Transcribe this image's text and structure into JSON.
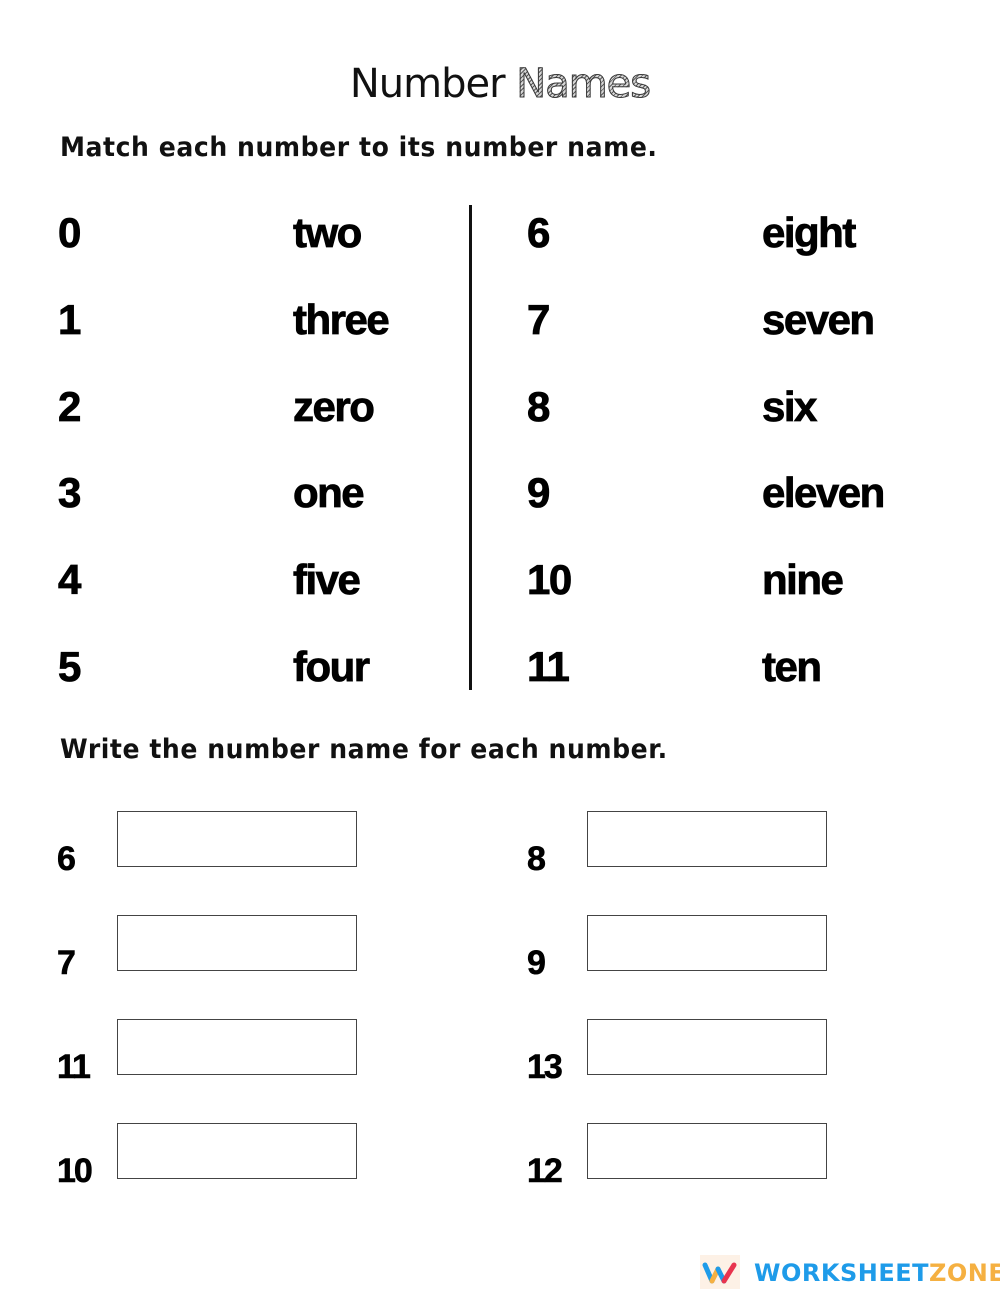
{
  "title": {
    "part1": "Number",
    "part2": "Names"
  },
  "section_match": {
    "instruction": "Match each number to its number name.",
    "left_column": {
      "numbers": [
        "0",
        "1",
        "2",
        "3",
        "4",
        "5"
      ],
      "names": [
        "two",
        "three",
        "zero",
        "one",
        "five",
        "four"
      ]
    },
    "right_column": {
      "numbers": [
        "6",
        "7",
        "8",
        "9",
        "10",
        "11"
      ],
      "names": [
        "eight",
        "seven",
        "six",
        "eleven",
        "nine",
        "ten"
      ]
    }
  },
  "section_write": {
    "instruction": "Write the number name for each number.",
    "left_items": [
      {
        "number": "6",
        "value": ""
      },
      {
        "number": "7",
        "value": ""
      },
      {
        "number": "11",
        "value": ""
      },
      {
        "number": "10",
        "value": ""
      }
    ],
    "right_items": [
      {
        "number": "8",
        "value": ""
      },
      {
        "number": "9",
        "value": ""
      },
      {
        "number": "13",
        "value": ""
      },
      {
        "number": "12",
        "value": ""
      }
    ]
  },
  "footer": {
    "logo_icon": "worksheetzone-w-icon",
    "brand_part1": "WORKSHEET",
    "brand_part2": "ZONE",
    "colors": {
      "brand_blue": "#1e9be9",
      "brand_orange": "#f5b041",
      "logo_red": "#e8344e",
      "logo_bg": "#fdf1e6"
    }
  }
}
